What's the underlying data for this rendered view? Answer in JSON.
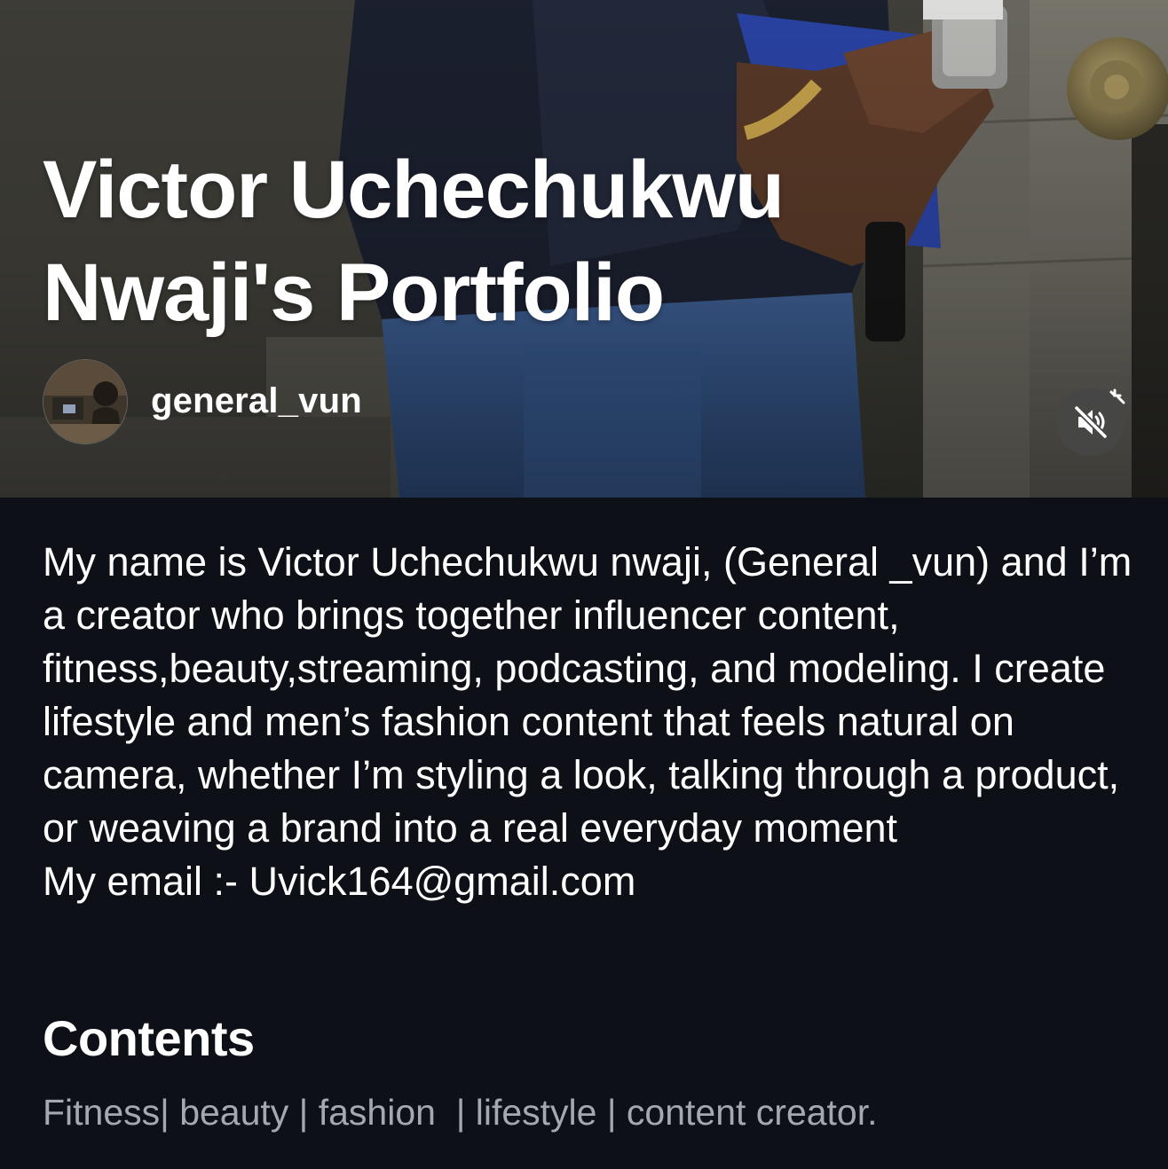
{
  "hero": {
    "title": "Victor Uchechukwu Nwaji's Portfolio",
    "author": "general_vun",
    "mute_icon": "speaker-muted-icon"
  },
  "bio": {
    "text": "My name is Victor Uchechukwu nwaji, (General _vun) and I’m a creator who brings together influencer content, fitness,beauty,streaming, podcasting, and modeling. I create lifestyle and men’s fashion content that feels natural on camera, whether I’m styling a look, talking through a product, or weaving a brand into a real everyday moment\nMy email :- Uvick164@gmail.com"
  },
  "contents": {
    "heading": "Contents",
    "tags": "Fitness| beauty | fashion  | lifestyle | content creator."
  },
  "colors": {
    "background": "#0d1117",
    "text": "#ffffff",
    "muted_text": "#a4a8b0"
  }
}
